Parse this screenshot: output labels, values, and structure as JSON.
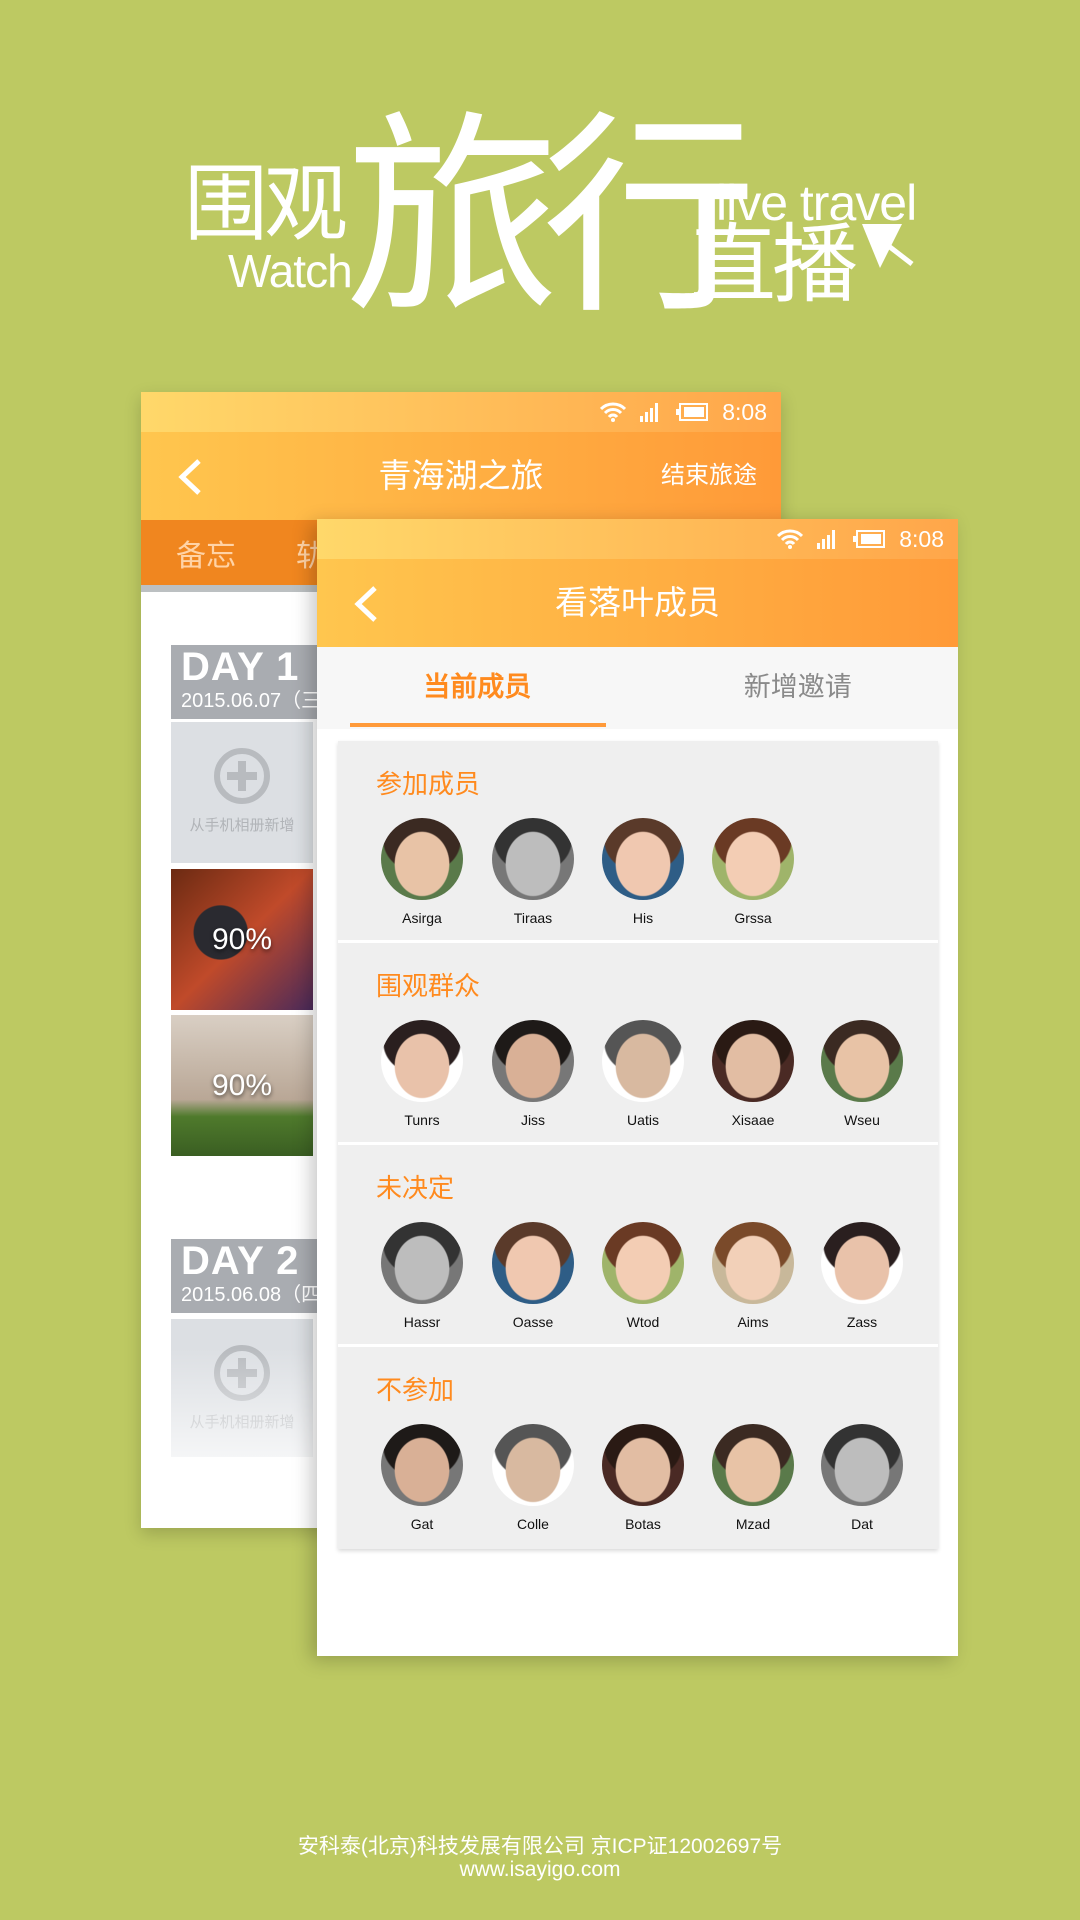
{
  "headline": {
    "weiguan": "围观",
    "watch": "Watch",
    "lvxing": "旅行",
    "live_travel": "live travel",
    "zhibo": "直播"
  },
  "status_bar": {
    "time": "8:08",
    "icons": [
      "wifi-icon",
      "signal-icon",
      "battery-icon"
    ]
  },
  "back_screen": {
    "title": "青海湖之旅",
    "action": "结束旅途",
    "tabs": [
      "备忘",
      "轨"
    ],
    "days": [
      {
        "day": "DAY  1",
        "date": "2015.06.07（三"
      },
      {
        "day": "DAY  2",
        "date": "2015.06.08（四"
      }
    ],
    "add_label": "从手机相册新增",
    "uploads": [
      {
        "progress": "90%",
        "value": 90
      },
      {
        "progress": "90%",
        "value": 90
      }
    ]
  },
  "front_screen": {
    "title": "看落叶成员",
    "tabs": [
      {
        "label": "当前成员",
        "active": true
      },
      {
        "label": "新增邀请",
        "active": false
      }
    ],
    "sections": [
      {
        "title": "参加成员",
        "members": [
          "Asirga",
          "Tiraas",
          "His",
          "Grssa"
        ]
      },
      {
        "title": "围观群众",
        "members": [
          "Tunrs",
          "Jiss",
          "Uatis",
          "Xisaae",
          "Wseu"
        ]
      },
      {
        "title": "未决定",
        "members": [
          "Hassr",
          "Oasse",
          "Wtod",
          "Aims",
          "Zass"
        ]
      },
      {
        "title": "不参加",
        "members": [
          "Gat",
          "Colle",
          "Botas",
          "Mzad",
          "Dat"
        ]
      }
    ]
  },
  "footer": {
    "company": "安科泰(北京)科技发展有限公司  京ICP证12002697号",
    "url": "www.isayigo.com"
  },
  "colors": {
    "background": "#bdc962",
    "accent": "#ff8a1e",
    "tab_bar": "#f0861f"
  }
}
